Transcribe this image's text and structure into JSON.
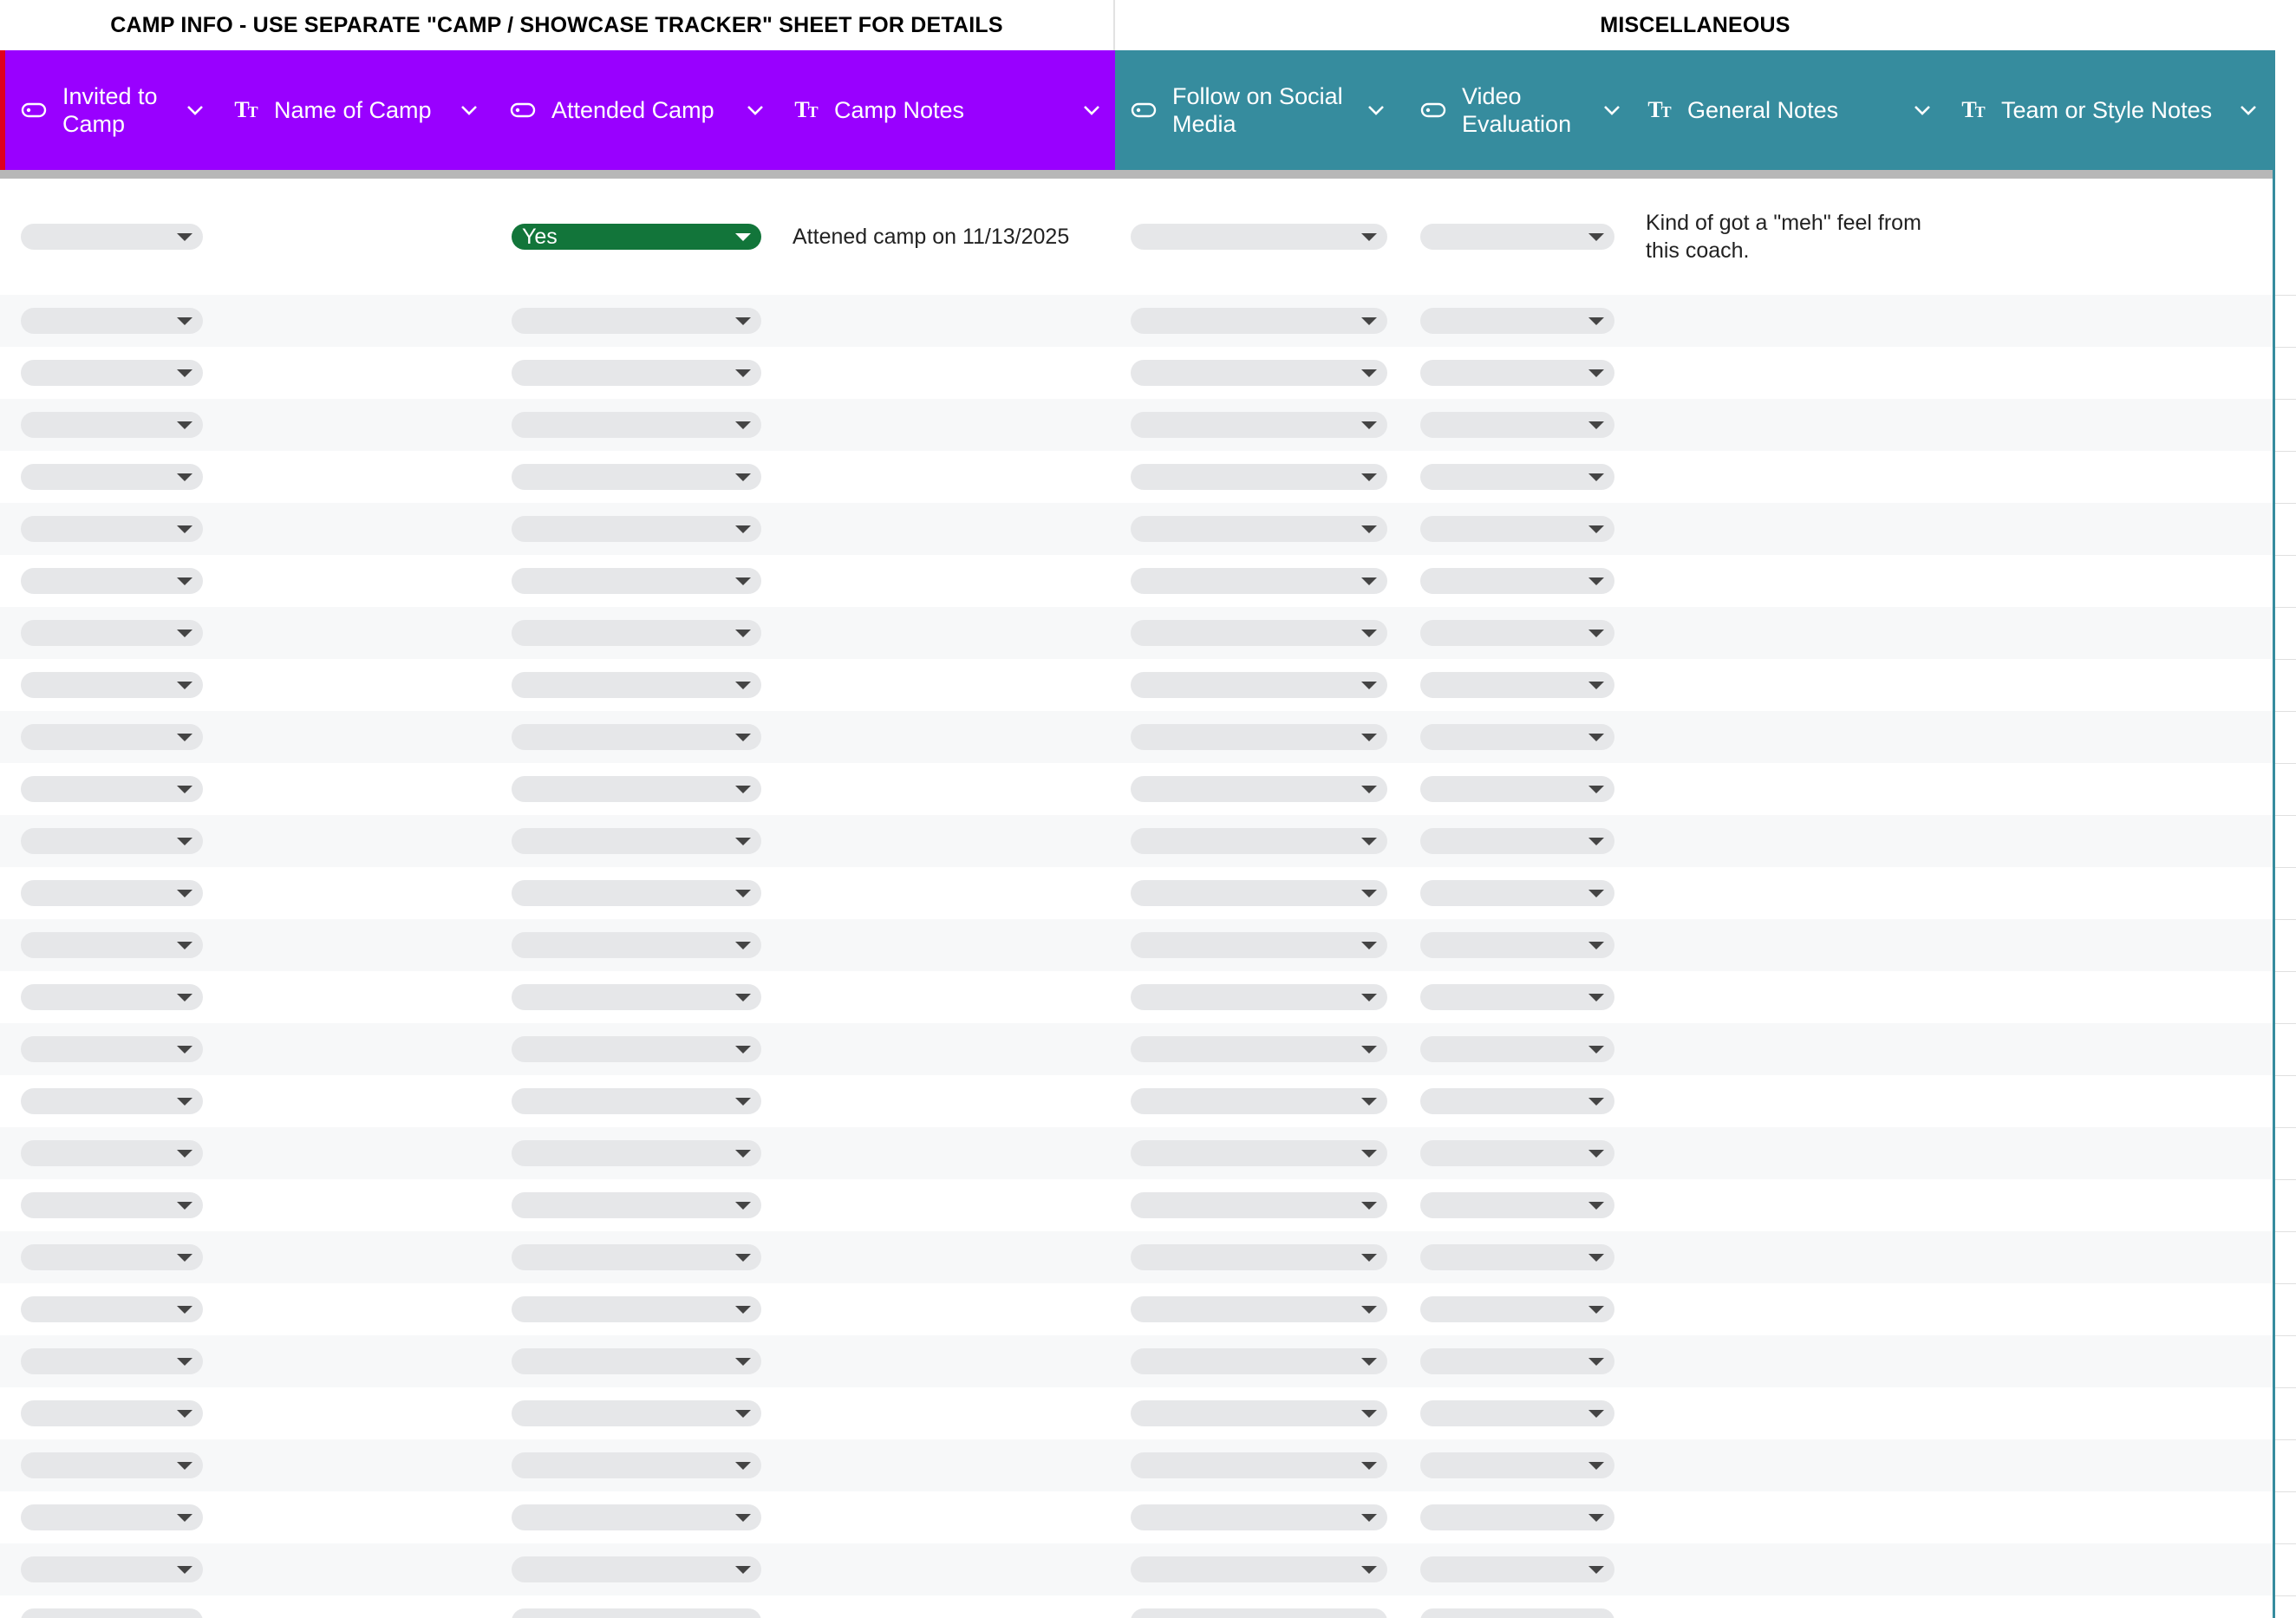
{
  "group_headers": {
    "camp_info": "CAMP INFO - USE SEPARATE \"CAMP / SHOWCASE TRACKER\" SHEET FOR DETAILS",
    "misc": "MISCELLANEOUS"
  },
  "colors": {
    "camp_header": "#9900ff",
    "misc_header": "#368c9e",
    "yes_chip": "#12753a",
    "empty_chip": "#e6e7e9",
    "alt_row": "#f7f8f9",
    "frozen_marker": "#e0001e"
  },
  "columns": [
    {
      "key": "invited",
      "label": "Invited to Camp",
      "type_icon": "dropdown-chip-icon"
    },
    {
      "key": "name",
      "label": "Name of Camp",
      "type_icon": "text-type-icon"
    },
    {
      "key": "attended",
      "label": "Attended Camp",
      "type_icon": "dropdown-chip-icon"
    },
    {
      "key": "camp_notes",
      "label": "Camp Notes",
      "type_icon": "text-type-icon"
    },
    {
      "key": "social",
      "label": "Follow on Social Media",
      "type_icon": "dropdown-chip-icon"
    },
    {
      "key": "video",
      "label": "Video Evaluation",
      "type_icon": "dropdown-chip-icon"
    },
    {
      "key": "general",
      "label": "General Notes",
      "type_icon": "text-type-icon"
    },
    {
      "key": "team",
      "label": "Team or Style Notes",
      "type_icon": "text-type-icon"
    }
  ],
  "rows": [
    {
      "invited": "",
      "name": "",
      "attended": "Yes",
      "camp_notes": "Attened camp on 11/13/2025",
      "social": "",
      "video": "",
      "general": "Kind of got a \"meh\" feel from this coach.",
      "team": ""
    }
  ],
  "empty_row_count": 26
}
